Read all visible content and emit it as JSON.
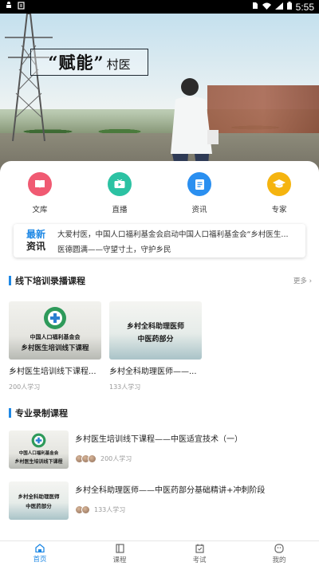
{
  "status_bar": {
    "time": "5:55",
    "icons": [
      "android-icon",
      "notification-icon",
      "sim-icon",
      "wifi-icon",
      "signal-icon",
      "battery-icon"
    ]
  },
  "hero": {
    "title_main": "“赋能”",
    "title_sub": "村医"
  },
  "categories": [
    {
      "label": "文库",
      "icon": "library-icon",
      "color": "#f05a72"
    },
    {
      "label": "直播",
      "icon": "live-icon",
      "color": "#2cc2a3"
    },
    {
      "label": "资讯",
      "icon": "news-icon",
      "color": "#2a8ff0"
    },
    {
      "label": "专家",
      "icon": "expert-icon",
      "color": "#f5b40f"
    }
  ],
  "news": {
    "badge_top": "最新",
    "badge_bottom": "资讯",
    "lines": [
      "大爱村医，中国人口福利基金会启动中国人口福利基金会“乡村医生...",
      "医德圆满——守望寸土，守护乡民"
    ]
  },
  "offline_section": {
    "title": "线下培训录播课程",
    "more": "更多",
    "courses": [
      {
        "title": "乡村医生培训线下课程...",
        "students": "200人学习",
        "thumb_lines": [
          "中国人口福利基金会",
          "乡村医生培训线下课程"
        ]
      },
      {
        "title": "乡村全科助理医师——...",
        "students": "133人学习",
        "thumb_lines": [
          "乡村全科助理医师",
          "中医药部分"
        ]
      }
    ]
  },
  "pro_section": {
    "title": "专业录制课程",
    "courses": [
      {
        "title": "乡村医生培训线下课程——中医适宜技术（一）",
        "students": "200人学习",
        "thumb_lines": [
          "中国人口福利基金会",
          "乡村医生培训线下课程"
        ]
      },
      {
        "title": "乡村全科助理医师——中医药部分基础精讲+冲刺阶段",
        "students": "133人学习",
        "thumb_lines": [
          "乡村全科助理医师",
          "中医药部分"
        ]
      }
    ]
  },
  "tabbar": {
    "accent": "#1e88e5",
    "tabs": [
      {
        "label": "首页",
        "icon": "home-icon",
        "active": true
      },
      {
        "label": "课程",
        "icon": "course-icon",
        "active": false
      },
      {
        "label": "考试",
        "icon": "exam-icon",
        "active": false
      },
      {
        "label": "我的",
        "icon": "profile-icon",
        "active": false
      }
    ]
  }
}
